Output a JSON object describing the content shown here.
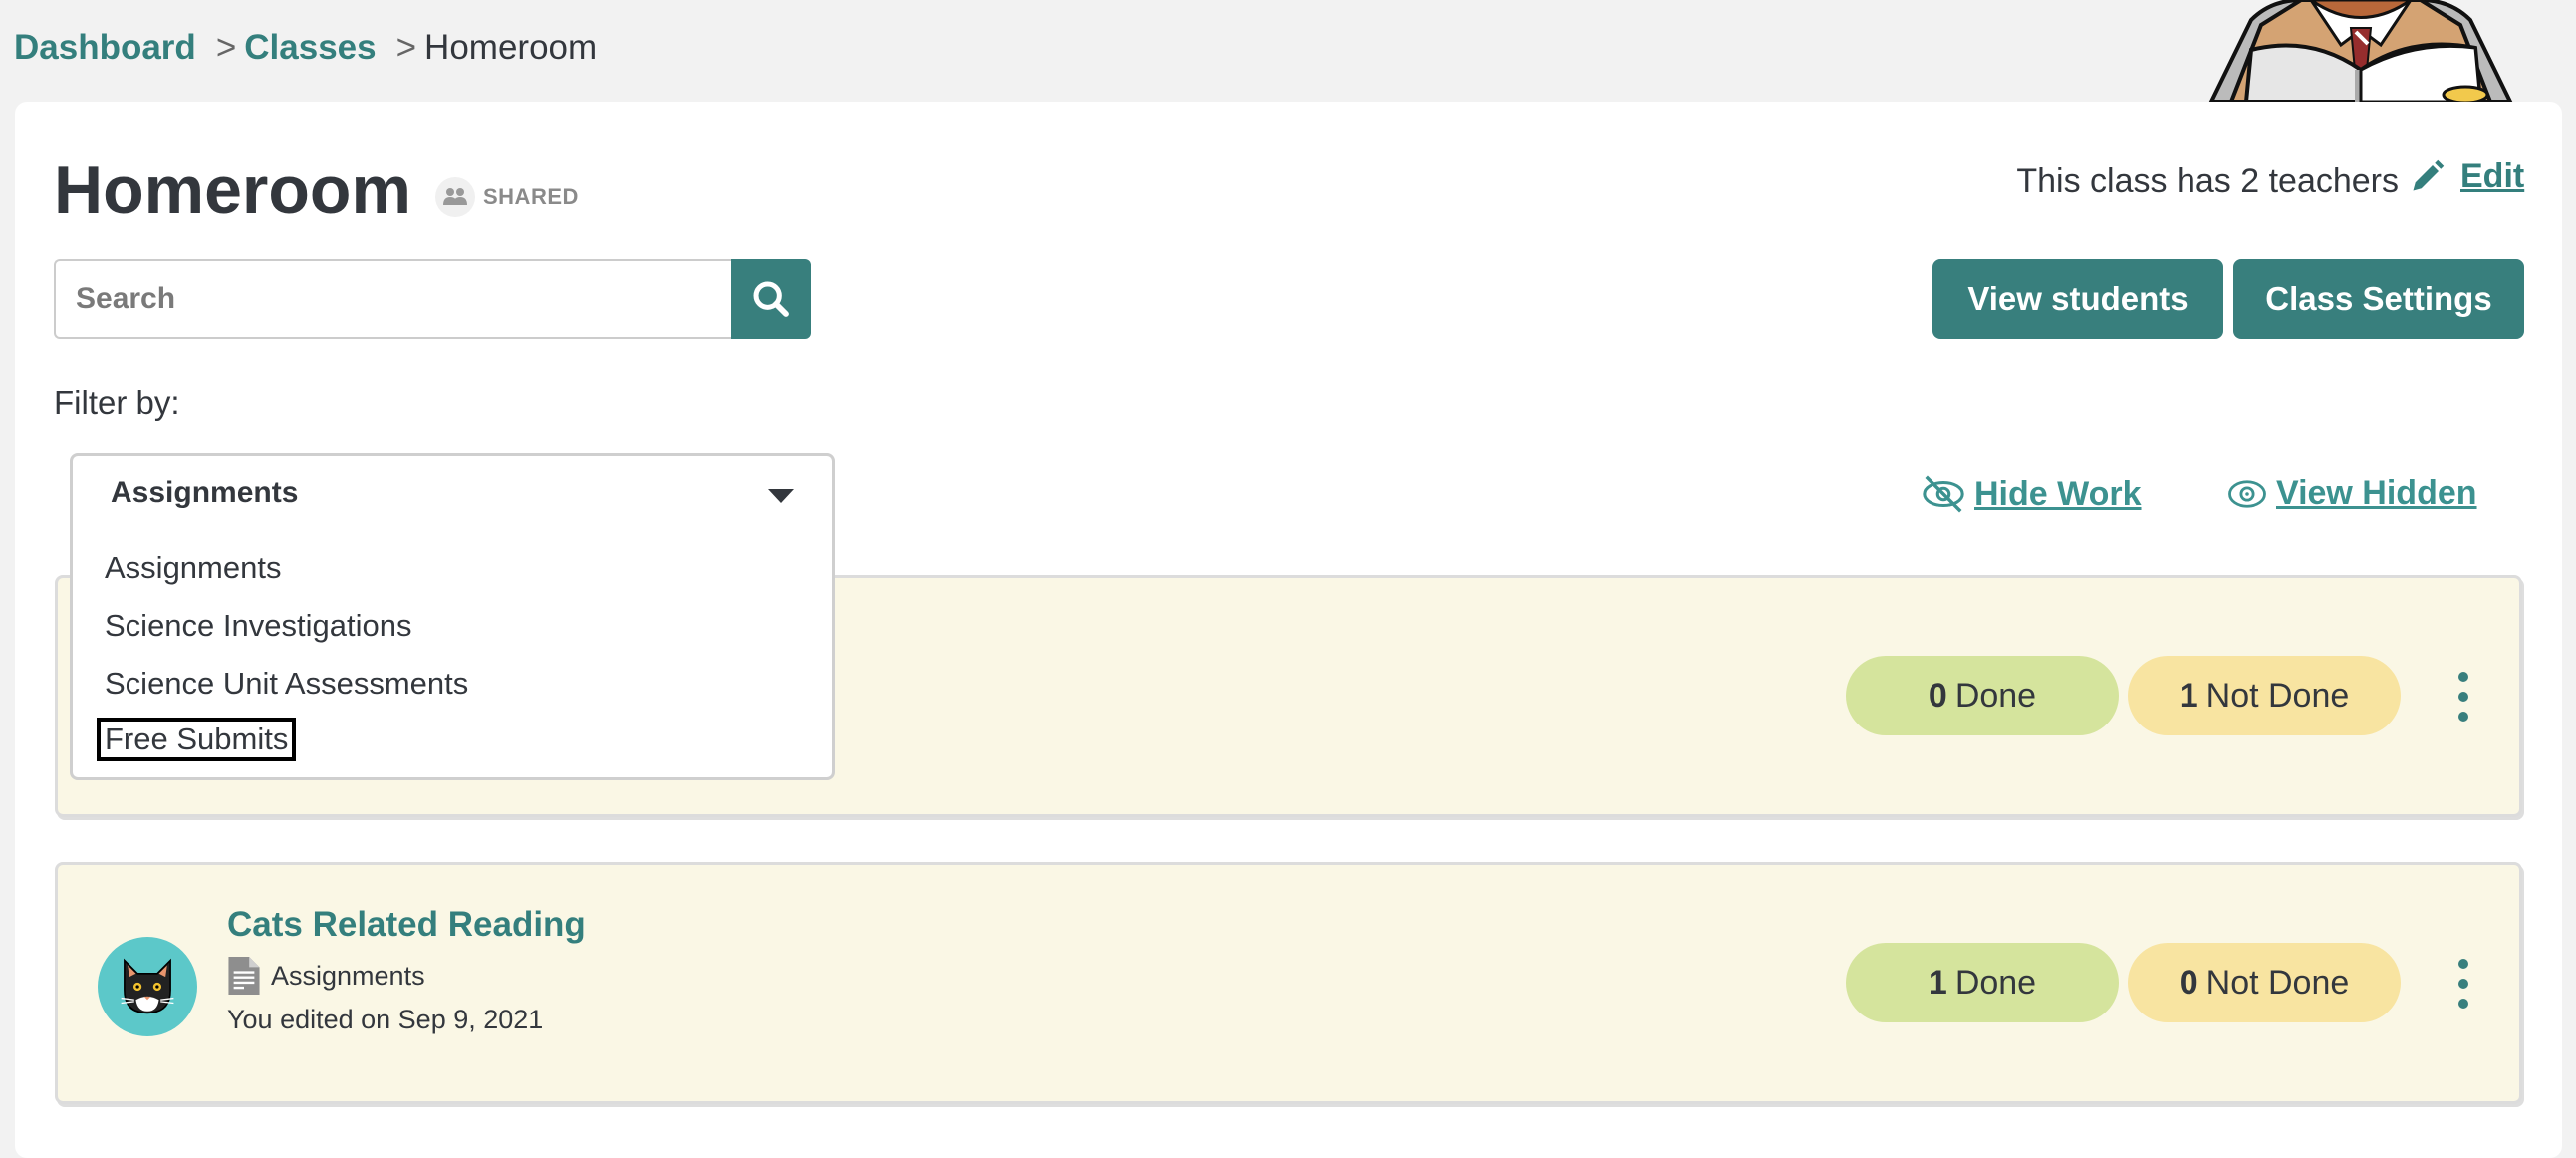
{
  "breadcrumb": {
    "items": [
      {
        "label": "Dashboard"
      },
      {
        "label": "Classes"
      }
    ],
    "separator": ">",
    "current": "Homeroom"
  },
  "header": {
    "title": "Homeroom",
    "shared_badge": "SHARED",
    "teachers_text": "This class has 2 teachers",
    "edit_label": "Edit"
  },
  "search": {
    "placeholder": "Search",
    "value": ""
  },
  "actions": {
    "view_students": "View students",
    "class_settings": "Class Settings"
  },
  "filter": {
    "label": "Filter by:",
    "selected": "Assignments",
    "options": [
      "Assignments",
      "Science Investigations",
      "Science Unit Assessments",
      "Free Submits"
    ],
    "focused_option": "Free Submits"
  },
  "links": {
    "hide_work": "Hide Work",
    "view_hidden": "View Hidden"
  },
  "cards": [
    {
      "title": "",
      "type": "",
      "meta": "",
      "done_count": "0",
      "done_label": "Done",
      "not_done_count": "1",
      "not_done_label": "Not Done"
    },
    {
      "title": "Cats Related Reading",
      "type": "Assignments",
      "meta": "You edited on Sep 9, 2021",
      "done_count": "1",
      "done_label": "Done",
      "not_done_count": "0",
      "not_done_label": "Not Done"
    }
  ],
  "colors": {
    "brand_teal": "#387f7d",
    "done_pill": "#d5e49d",
    "not_done_pill": "#f8e4a1",
    "card_bg": "#faf7e5"
  }
}
